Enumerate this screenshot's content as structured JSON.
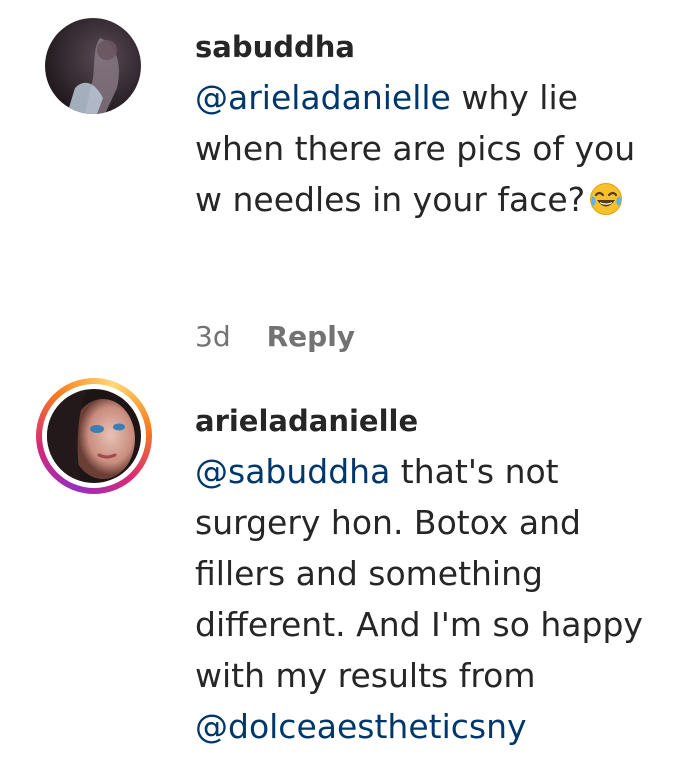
{
  "comments": [
    {
      "username": "sabuddha",
      "mention": "@arieladanielle",
      "text": " why lie when there are pics of you w needles in your face?",
      "emoji": "face-with-tears-of-joy",
      "timestamp": "3d",
      "reply_label": "Reply",
      "story_ring": false
    },
    {
      "username": "arieladanielle",
      "mention": "@sabuddha",
      "text": " that's not surgery hon. Botox and fillers and something different. And I'm so happy with my results from ",
      "mention_end": "@dolceaestheticsny",
      "story_ring": true
    }
  ],
  "colors": {
    "mention": "#00376b",
    "text": "#262626",
    "meta": "#737373",
    "story_ring_start": "#feda75",
    "story_ring_mid": "#d62976",
    "story_ring_end": "#962fbf"
  }
}
